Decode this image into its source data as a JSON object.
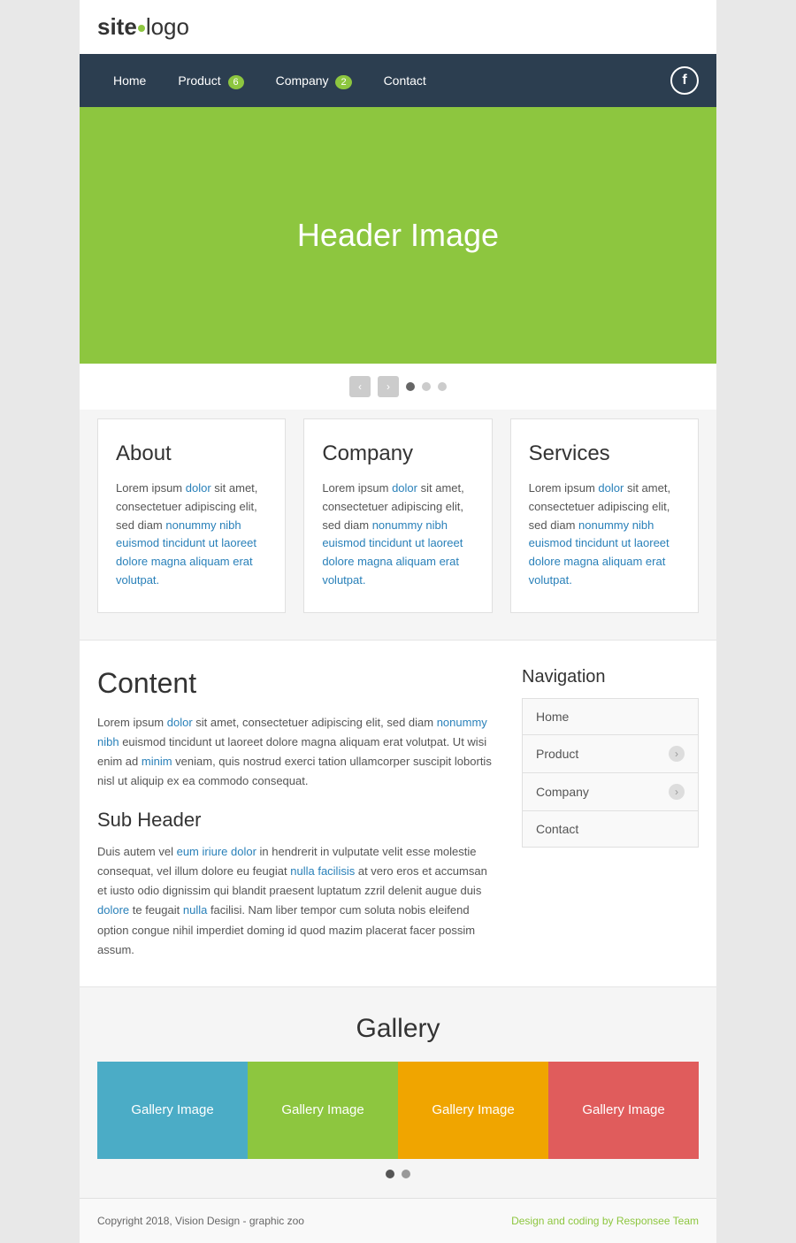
{
  "header": {
    "logo_site": "site",
    "logo_logo": "logo"
  },
  "nav": {
    "items": [
      {
        "label": "Home",
        "badge": null
      },
      {
        "label": "Product",
        "badge": "6"
      },
      {
        "label": "Company",
        "badge": "2"
      },
      {
        "label": "Contact",
        "badge": null
      }
    ],
    "facebook_icon": "f"
  },
  "hero": {
    "text": "Header Image"
  },
  "slider": {
    "prev": "‹",
    "next": "›"
  },
  "cards": [
    {
      "title": "About",
      "text": "Lorem ipsum dolor sit amet, consectetuer adipiscing elit, sed diam nonummy nibh euismod tincidunt ut laoreet dolore magna aliquam erat volutpat."
    },
    {
      "title": "Company",
      "text": "Lorem ipsum dolor sit amet, consectetuer adipiscing elit, sed diam nonummy nibh euismod tincidunt ut laoreet dolore magna aliquam erat volutpat."
    },
    {
      "title": "Services",
      "text": "Lorem ipsum dolor sit amet, consectetuer adipiscing elit, sed diam nonummy nibh euismod tincidunt ut laoreet dolore magna aliquam erat volutpat."
    }
  ],
  "content": {
    "title": "Content",
    "text": "Lorem ipsum dolor sit amet, consectetuer adipiscing elit, sed diam nonummy nibh euismod tincidunt ut laoreet dolore magna aliquam erat volutpat. Ut wisi enim ad minim veniam, quis nostrud exerci tation ullamcorper suscipit lobortis nisl ut aliquip ex ea commodo consequat.",
    "subheader": "Sub Header",
    "subtext": "Duis autem vel eum iriure dolor in hendrerit in vulputate velit esse molestie consequat, vel illum dolore eu feugiat nulla facilisis at vero eros et accumsan et iusto odio dignissim qui blandit praesent luptatum zzril delenit augue duis dolore te feugait nulla facilisi. Nam liber tempor cum soluta nobis eleifend option congue nihil imperdiet doming id quod mazim placerat facer possim assum."
  },
  "sidebar": {
    "title": "Navigation",
    "items": [
      {
        "label": "Home",
        "arrow": false
      },
      {
        "label": "Product",
        "arrow": true
      },
      {
        "label": "Company",
        "arrow": true
      },
      {
        "label": "Contact",
        "arrow": false
      }
    ]
  },
  "gallery": {
    "title": "Gallery",
    "images": [
      {
        "label": "Gallery Image",
        "color": "blue"
      },
      {
        "label": "Gallery Image",
        "color": "olive"
      },
      {
        "label": "Gallery Image",
        "color": "orange"
      },
      {
        "label": "Gallery Image",
        "color": "red"
      }
    ]
  },
  "footer": {
    "copyright": "Copyright 2018, Vision Design - graphic zoo",
    "link_text": "Design and coding by Responsee Team",
    "link_url": "#"
  }
}
